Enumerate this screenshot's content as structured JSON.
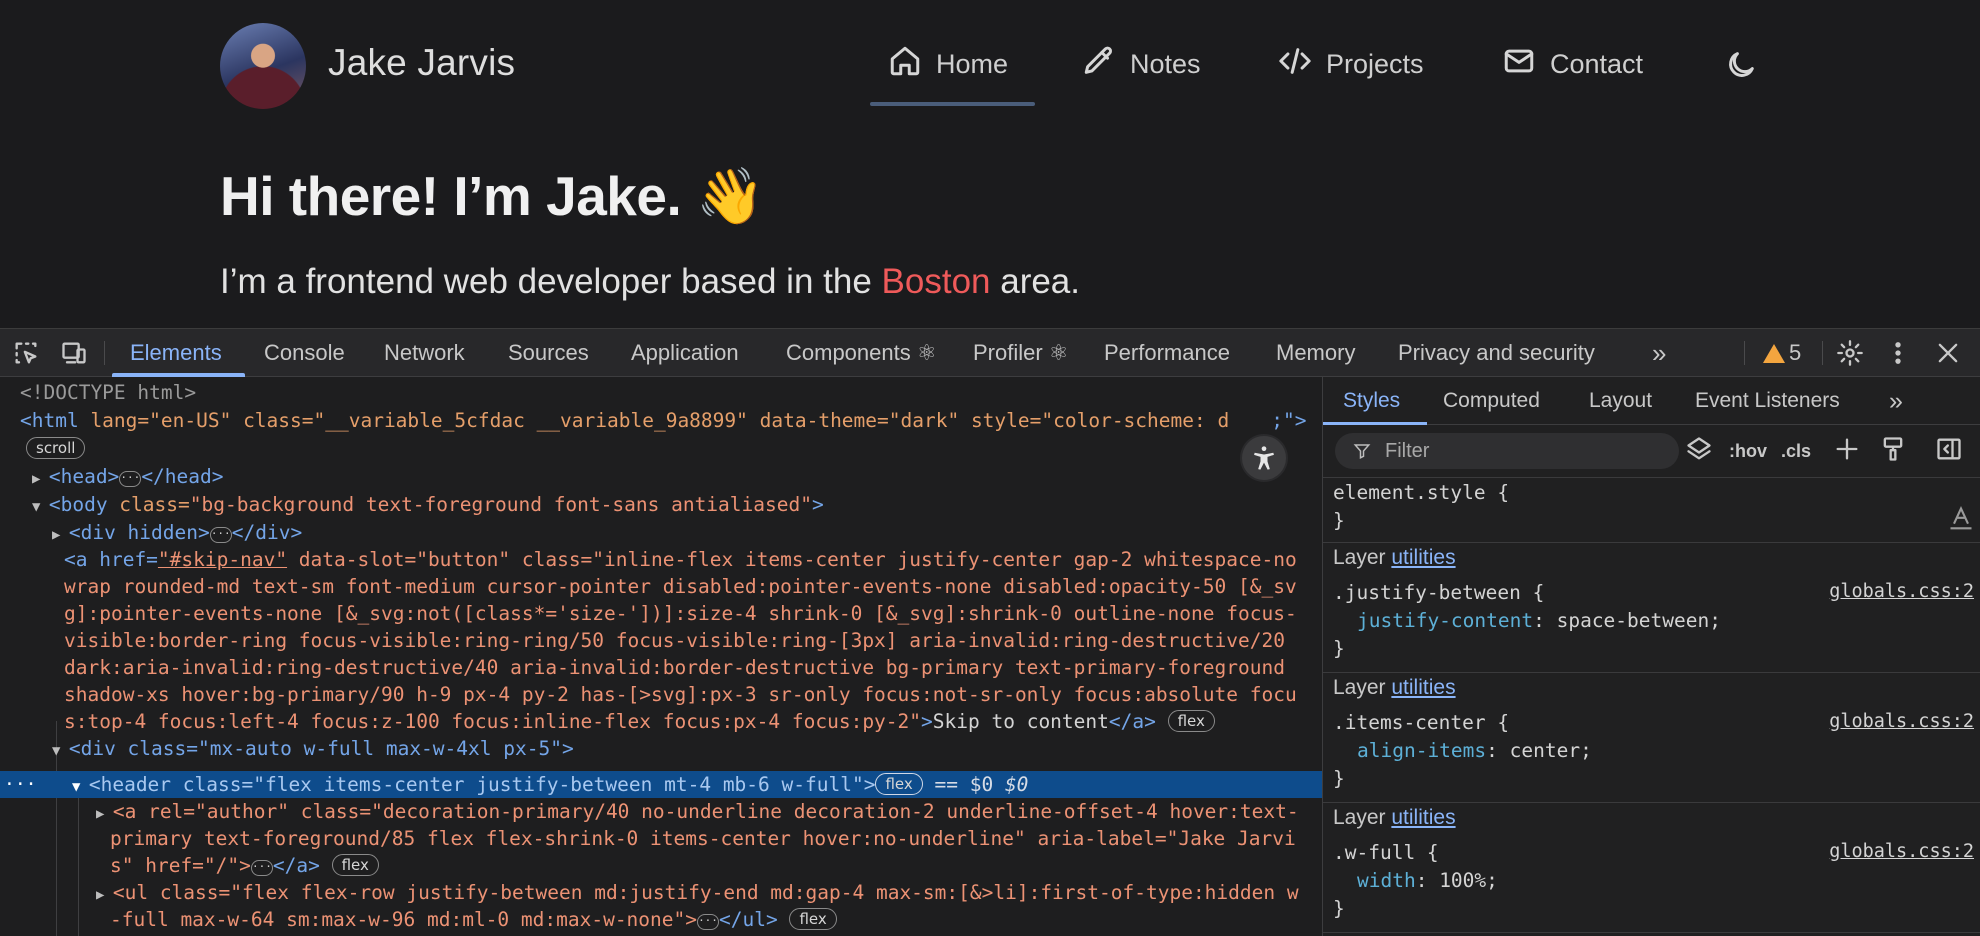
{
  "site": {
    "name": "Jake Jarvis",
    "nav": [
      {
        "label": "Home",
        "icon": "home-icon",
        "active": true
      },
      {
        "label": "Notes",
        "icon": "pencil-icon"
      },
      {
        "label": "Projects",
        "icon": "code-icon"
      },
      {
        "label": "Contact",
        "icon": "mail-icon"
      }
    ],
    "theme_toggle_icon": "moon-icon",
    "hero_title": "Hi there! I’m Jake. 👋",
    "hero_sub_before": "I’m a frontend web developer based in the ",
    "hero_sub_accent": "Boston",
    "hero_sub_after": " area.",
    "accent_color": "#ef5a5a"
  },
  "devtools": {
    "tabs": [
      "Elements",
      "Console",
      "Network",
      "Sources",
      "Application",
      "Components ⚛",
      "Profiler ⚛",
      "Performance",
      "Memory",
      "Privacy and security"
    ],
    "active_tab": "Elements",
    "more_tabs": "»",
    "warning_count": "5",
    "dom": {
      "doctype": "<!DOCTYPE html>",
      "html_open_tag": "<html",
      "html_attrs": " lang=\"en-US\" class=\"__variable_5cfdac __variable_9a8899\" data-theme=\"dark\" style=\"color-scheme: d",
      "html_end": ";\">",
      "scroll_badge": "scroll",
      "head": "<head>",
      "head_close": "</head>",
      "body_open": "<body",
      "body_class_attr": " class=",
      "body_class": "\"bg-background text-foreground font-sans antialiased\"",
      "div_hidden": "<div hidden>",
      "div_close": "</div>",
      "a_line1_pre": "<a href=",
      "a_line1_link": "\"#skip-nav\"",
      "a_line1_rest": " data-slot=\"button\" class=\"inline-flex items-center justify-center gap-2 whitespace-no",
      "a_line2": "wrap rounded-md text-sm font-medium cursor-pointer disabled:pointer-events-none disabled:opacity-50 [&_sv",
      "a_line3": "g]:pointer-events-none [&_svg:not([class*='size-'])]:size-4 shrink-0 [&_svg]:shrink-0 outline-none focus-",
      "a_line4": "visible:border-ring focus-visible:ring-ring/50 focus-visible:ring-[3px] aria-invalid:ring-destructive/20",
      "a_line5": "dark:aria-invalid:ring-destructive/40 aria-invalid:border-destructive bg-primary text-primary-foreground",
      "a_line6": "shadow-xs hover:bg-primary/90 h-9 px-4 py-2 has-[>svg]:px-3 sr-only focus:not-sr-only focus:absolute focu",
      "a_line7_attr": "s:top-4 focus:left-4 focus:z-100 focus:inline-flex focus:px-4 focus:py-2\"",
      "a_line7_text": "Skip to content",
      "a_close": "</a>",
      "flex_badge": "flex",
      "div_wrapper": "<div class=\"mx-auto w-full max-w-4xl px-5\">",
      "header_line": "<header class=\"flex items-center justify-between mt-4 mb-6 w-full\">",
      "header_dollar": " == $0",
      "author_line1": "<a rel=\"author\" class=\"decoration-primary/40 no-underline decoration-2 underline-offset-4 hover:text-",
      "author_line2": "primary text-foreground/85 flex flex-shrink-0 items-center hover:no-underline\" aria-label=\"Jake Jarvi",
      "author_line3": "s\" href=\"/\">",
      "ul_line1": "<ul class=\"flex flex-row justify-between md:justify-end md:gap-4 max-sm:[&>li]:first-of-type:hidden w",
      "ul_line2": "-full max-w-64 sm:max-w-96 md:ml-0 md:max-w-none\">",
      "ul_close": "</ul>",
      "selected_dots": "···"
    },
    "styles": {
      "tabs": [
        "Styles",
        "Computed",
        "Layout",
        "Event Listeners"
      ],
      "active_tab": "Styles",
      "more_tabs": "»",
      "filter_placeholder": "Filter",
      "hov": ":hov",
      "cls": ".cls",
      "element_style_selector": "element.style {",
      "close_brace": "}",
      "layer_label": "Layer",
      "layer_link": "utilities",
      "rules": [
        {
          "selector": ".justify-between {",
          "prop": "justify-content",
          "value": "space-between;",
          "source": "globals.css:2"
        },
        {
          "selector": ".items-center {",
          "prop": "align-items",
          "value": "center;",
          "source": "globals.css:2"
        },
        {
          "selector": ".w-full {",
          "prop": "width",
          "value": "100%;",
          "source": "globals.css:2"
        }
      ]
    }
  }
}
